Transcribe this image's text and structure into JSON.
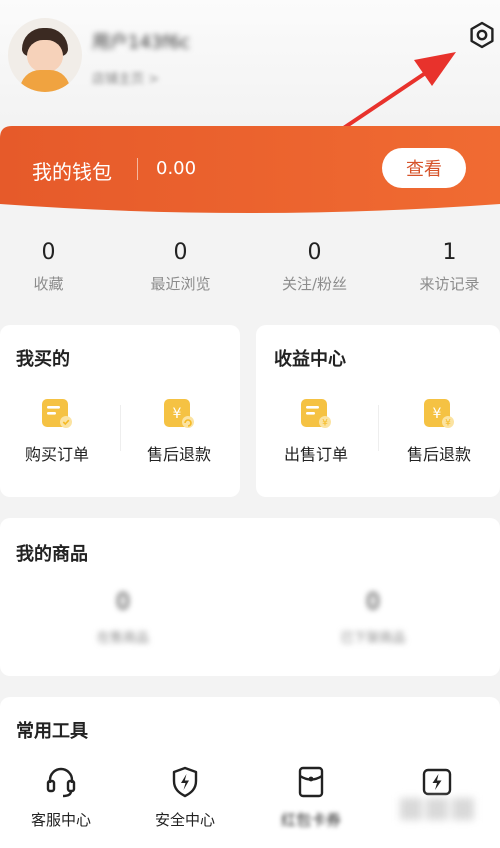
{
  "header": {
    "username": "用户143f6c",
    "subline": "店铺主页 >"
  },
  "wallet": {
    "title": "我的钱包",
    "amount": "0.00",
    "view_label": "查看"
  },
  "stats": [
    {
      "value": "0",
      "label": "收藏"
    },
    {
      "value": "0",
      "label": "最近浏览"
    },
    {
      "value": "0",
      "label": "关注/粉丝"
    },
    {
      "value": "1",
      "label": "来访记录"
    }
  ],
  "bought": {
    "title": "我买的",
    "items": [
      {
        "label": "购买订单",
        "icon": "order-icon"
      },
      {
        "label": "售后退款",
        "icon": "refund-icon"
      }
    ]
  },
  "income": {
    "title": "收益中心",
    "items": [
      {
        "label": "出售订单",
        "icon": "sell-order-icon"
      },
      {
        "label": "售后退款",
        "icon": "refund-icon"
      }
    ]
  },
  "products": {
    "title": "我的商品",
    "stats": [
      {
        "value": "0",
        "label": "在售商品"
      },
      {
        "value": "0",
        "label": "已下架商品"
      }
    ]
  },
  "tools": {
    "title": "常用工具",
    "items": [
      {
        "label": "客服中心",
        "icon": "headset-icon"
      },
      {
        "label": "安全中心",
        "icon": "shield-bolt-icon"
      },
      {
        "label": "红包卡券",
        "icon": "red-packet-icon"
      },
      {
        "label": "",
        "icon": "flash-icon"
      }
    ]
  },
  "colors": {
    "wallet_gradient_start": "#f0662c",
    "wallet_gradient_end": "#e3572a",
    "icon_yellow": "#f5c243",
    "annotation_red": "#e8322c"
  }
}
